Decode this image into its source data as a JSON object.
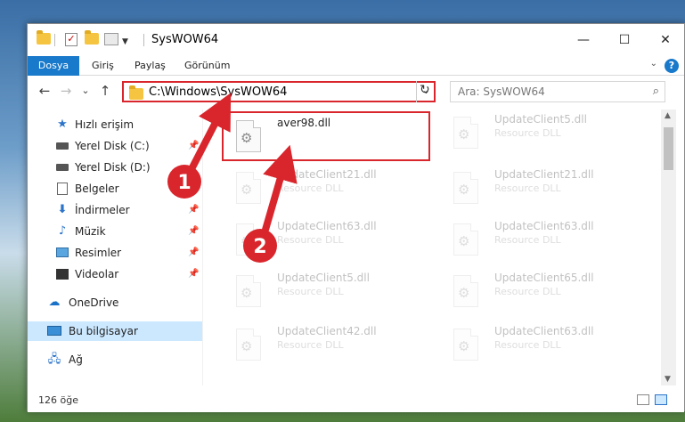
{
  "window": {
    "title": "SysWOW64",
    "controls": {
      "minimize": "—",
      "maximize": "☐",
      "close": "✕"
    }
  },
  "ribbon": {
    "tabs": [
      {
        "label": "Dosya",
        "active": true
      },
      {
        "label": "Giriş"
      },
      {
        "label": "Paylaş"
      },
      {
        "label": "Görünüm"
      }
    ],
    "help": "?"
  },
  "navigation": {
    "back": "←",
    "forward": "→",
    "recent": "⌄",
    "up": "↑",
    "address": "C:\\Windows\\SysWOW64",
    "refresh": "↻",
    "search_placeholder": "Ara: SysWOW64"
  },
  "sidebar": {
    "items": [
      {
        "label": "Hızlı erişim",
        "icon": "star-icon"
      },
      {
        "label": "Yerel Disk (C:)",
        "icon": "drive-icon",
        "pinned": true
      },
      {
        "label": "Yerel Disk (D:)",
        "icon": "drive-icon"
      },
      {
        "label": "Belgeler",
        "icon": "documents-icon"
      },
      {
        "label": "İndirmeler",
        "icon": "downloads-icon",
        "pinned": true
      },
      {
        "label": "Müzik",
        "icon": "music-icon",
        "pinned": true
      },
      {
        "label": "Resimler",
        "icon": "pictures-icon",
        "pinned": true
      },
      {
        "label": "Videolar",
        "icon": "videos-icon",
        "pinned": true
      },
      {
        "label": "OneDrive",
        "icon": "onedrive-icon"
      },
      {
        "label": "Bu bilgisayar",
        "icon": "this-pc-icon",
        "selected": true
      },
      {
        "label": "Ağ",
        "icon": "network-icon"
      }
    ]
  },
  "files": [
    {
      "name": "aver98.dll",
      "desc": ""
    },
    {
      "name": "UpdateClient5.dll",
      "desc": "Resource DLL"
    },
    {
      "name": "UpdateClient21.dll",
      "desc": "Resource DLL"
    },
    {
      "name": "UpdateClient21.dll",
      "desc": "Resource DLL"
    },
    {
      "name": "UpdateClient63.dll",
      "desc": "Resource DLL"
    },
    {
      "name": "UpdateClient63.dll",
      "desc": "Resource DLL"
    },
    {
      "name": "UpdateClient5.dll",
      "desc": "Resource DLL"
    },
    {
      "name": "UpdateClient65.dll",
      "desc": "Resource DLL"
    },
    {
      "name": "UpdateClient42.dll",
      "desc": "Resource DLL"
    },
    {
      "name": "UpdateClient63.dll",
      "desc": "Resource DLL"
    }
  ],
  "status": {
    "item_count": "126 öğe"
  },
  "annotations": {
    "step1": "1",
    "step2": "2",
    "color": "#d9262c"
  }
}
